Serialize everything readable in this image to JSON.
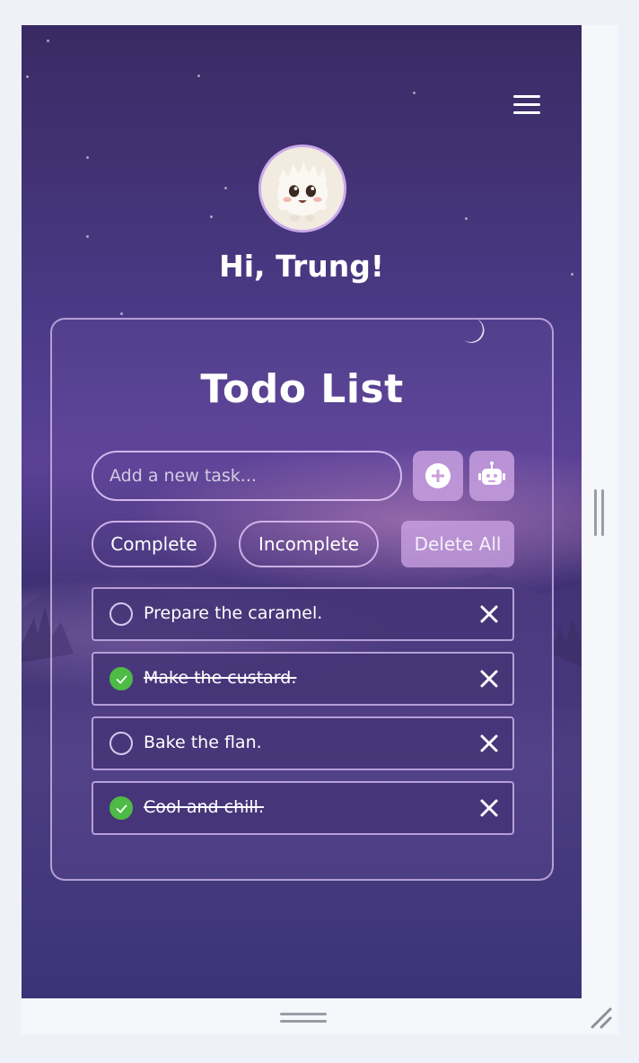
{
  "app": {
    "greeting": "Hi, Trung!",
    "avatar_alt": "fluffy white creature avatar"
  },
  "header": {
    "menu_icon": "hamburger-menu-icon"
  },
  "card": {
    "title": "Todo List",
    "input_placeholder": "Add a new task...",
    "input_value": "",
    "add_icon": "plus-circle-icon",
    "ai_icon": "robot-icon"
  },
  "filters": {
    "complete_label": "Complete",
    "incomplete_label": "Incomplete",
    "delete_all_label": "Delete All"
  },
  "todos": [
    {
      "text": "Prepare the caramel.",
      "completed": false
    },
    {
      "text": "Make the custard.",
      "completed": true
    },
    {
      "text": "Bake the flan.",
      "completed": false
    },
    {
      "text": "Cool and chill.",
      "completed": true
    }
  ],
  "colors": {
    "accent": "#c9a9ea",
    "check_done": "#4dbb45",
    "bg_top": "#3a2a63",
    "bg_bottom": "#3c3478"
  }
}
